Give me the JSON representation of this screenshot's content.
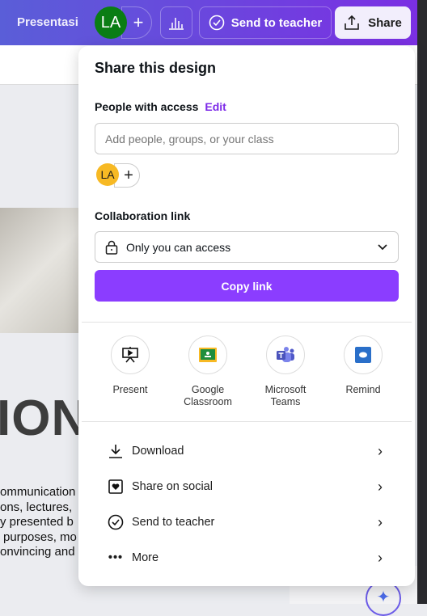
{
  "topbar": {
    "title": "Presentasi",
    "avatar": "LA",
    "add": "+",
    "send_to_teacher": "Send to teacher",
    "share": "Share"
  },
  "canvas": {
    "heading": "ION",
    "body_lines": [
      "ommunication",
      "ons, lectures,",
      "y presented b",
      "purposes, mo",
      "onvincing and"
    ]
  },
  "panel": {
    "title": "Share this design",
    "people_label": "People with access",
    "edit": "Edit",
    "input_placeholder": "Add people, groups, or your class",
    "member_avatar": "LA",
    "add_member": "+",
    "collab_label": "Collaboration link",
    "access_value": "Only you can access",
    "copy_link": "Copy link",
    "apps": [
      {
        "label": "Present",
        "icon": "present-icon"
      },
      {
        "label": "Google Classroom",
        "icon": "google-classroom-icon"
      },
      {
        "label": "Microsoft Teams",
        "icon": "microsoft-teams-icon"
      },
      {
        "label": "Remind",
        "icon": "remind-icon"
      }
    ],
    "menu": [
      {
        "label": "Download",
        "icon": "download-icon"
      },
      {
        "label": "Share on social",
        "icon": "heart-icon"
      },
      {
        "label": "Send to teacher",
        "icon": "check-circle-icon"
      },
      {
        "label": "More",
        "icon": "more-icon"
      }
    ]
  },
  "colors": {
    "accent": "#8b3dff",
    "edit": "#7d2ae8",
    "avatar_green": "#0a7d14",
    "avatar_yellow": "#f7b924"
  }
}
